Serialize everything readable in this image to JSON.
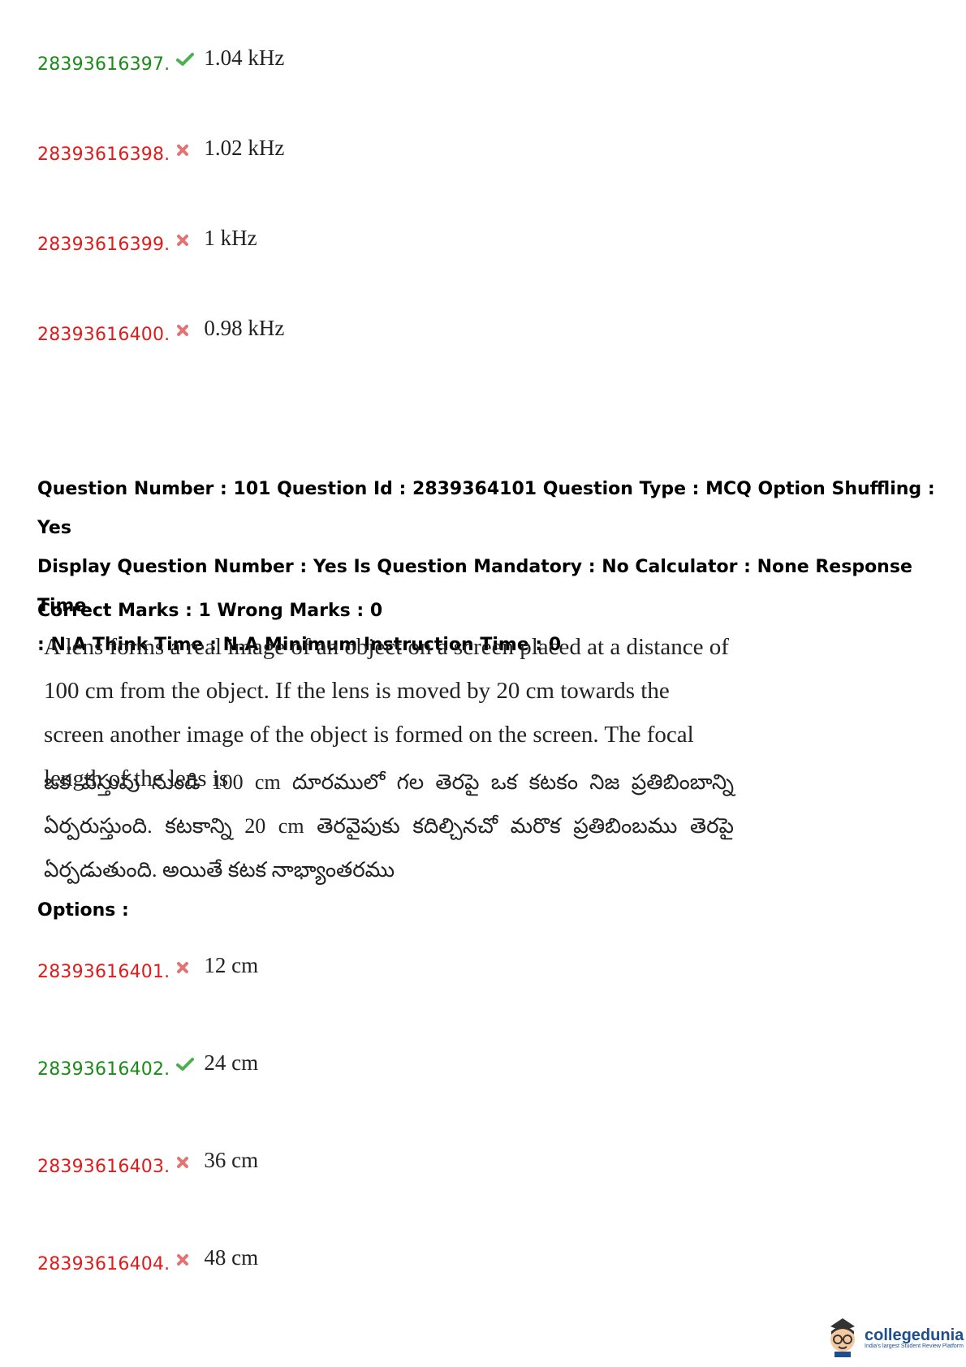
{
  "prev_options": [
    {
      "id": "28393616397.",
      "value": "1.04 kHz",
      "status": "correct"
    },
    {
      "id": "28393616398.",
      "value": "1.02 kHz",
      "status": "wrong"
    },
    {
      "id": "28393616399.",
      "value": "1 kHz",
      "status": "wrong"
    },
    {
      "id": "28393616400.",
      "value": "0.98 kHz",
      "status": "wrong"
    }
  ],
  "question_meta": {
    "line1": "Question Number : 101 Question Id : 2839364101 Question Type : MCQ Option Shuffling : Yes",
    "line2": "Display Question Number : Yes Is Question Mandatory : No Calculator : None Response Time",
    "line3": ": N.A Think Time : N.A Minimum Instruction Time : 0",
    "marks": "Correct Marks : 1 Wrong Marks : 0"
  },
  "question_text_en": "A lens forms a real image of an object on a screen placed at a distance of 100 cm from the object. If the lens is moved by 20 cm towards the screen another image of the object is formed on the screen. The focal length of the lens is",
  "question_text_te": "ఒక వస్తువు నుండి 100 cm దూరములో గల తెరపై ఒక కటకం నిజ ప్రతిబింబాన్ని ఏర్పరుస్తుంది. కటకాన్ని 20 cm తెరవైపుకు కదిల్చినచో మరొక ప్రతిబింబము తెరపై ఏర్పడుతుంది. అయితే కటక నాభ్యాంతరము",
  "options_label": "Options :",
  "options": [
    {
      "id": "28393616401.",
      "value": "12 cm",
      "status": "wrong"
    },
    {
      "id": "28393616402.",
      "value": "24 cm",
      "status": "correct"
    },
    {
      "id": "28393616403.",
      "value": "36 cm",
      "status": "wrong"
    },
    {
      "id": "28393616404.",
      "value": "48 cm",
      "status": "wrong"
    }
  ],
  "logo": {
    "brand": "collegedunia",
    "tagline": "India's largest Student Review Platform"
  },
  "colors": {
    "correct": "#1a8a1a",
    "wrong": "#e01b1b",
    "brand": "#1f4e8c"
  }
}
